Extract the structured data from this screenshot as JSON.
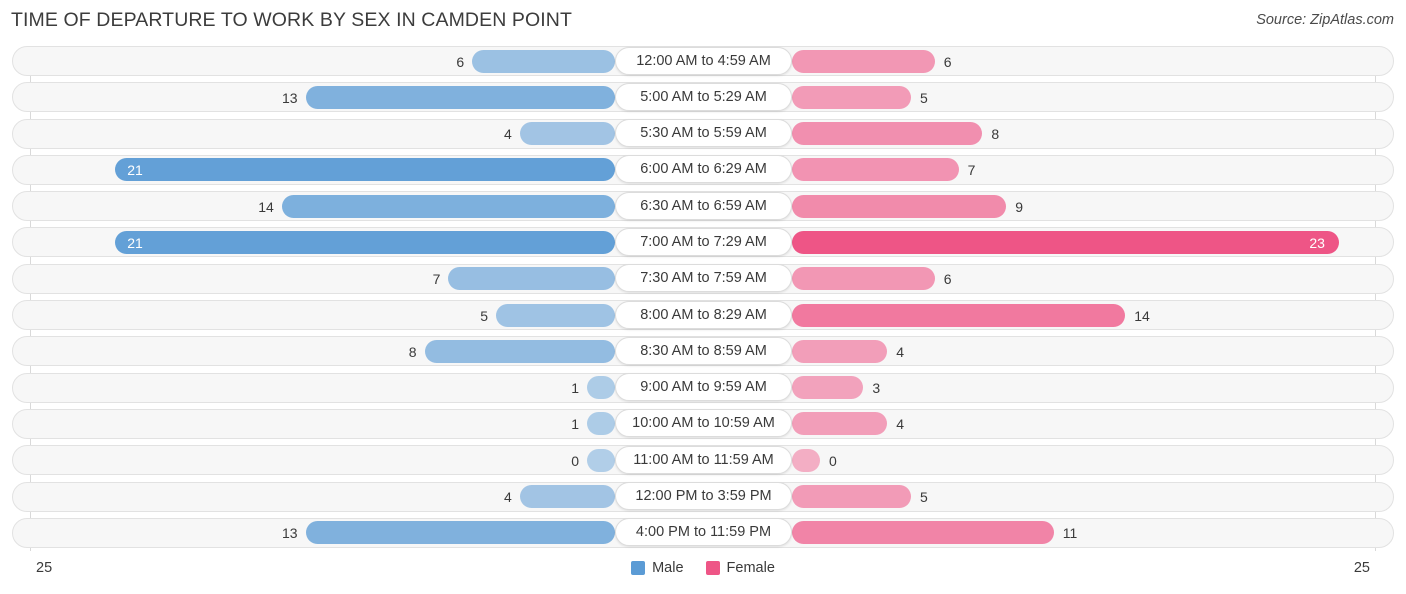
{
  "header": {
    "title": "TIME OF DEPARTURE TO WORK BY SEX IN CAMDEN POINT",
    "source": "Source: ZipAtlas.com"
  },
  "legend": {
    "male_label": "Male",
    "female_label": "Female",
    "male_color": "#5b9bd5",
    "female_color": "#ee5586"
  },
  "axis": {
    "left_max": "25",
    "right_max": "25"
  },
  "chart_data": {
    "type": "bar",
    "subtype": "diverging-bidirectional-bar",
    "title": "TIME OF DEPARTURE TO WORK BY SEX IN CAMDEN POINT",
    "xlabel": "",
    "ylabel": "",
    "xlim": [
      25,
      25
    ],
    "grid": true,
    "legend_position": "bottom-center",
    "categories": [
      "12:00 AM to 4:59 AM",
      "5:00 AM to 5:29 AM",
      "5:30 AM to 5:59 AM",
      "6:00 AM to 6:29 AM",
      "6:30 AM to 6:59 AM",
      "7:00 AM to 7:29 AM",
      "7:30 AM to 7:59 AM",
      "8:00 AM to 8:29 AM",
      "8:30 AM to 8:59 AM",
      "9:00 AM to 9:59 AM",
      "10:00 AM to 10:59 AM",
      "11:00 AM to 11:59 AM",
      "12:00 PM to 3:59 PM",
      "4:00 PM to 11:59 PM"
    ],
    "series": [
      {
        "name": "Male",
        "direction": "left",
        "color": "#5b9bd5",
        "values": [
          6,
          13,
          4,
          21,
          14,
          21,
          7,
          5,
          8,
          1,
          1,
          0,
          4,
          13
        ]
      },
      {
        "name": "Female",
        "direction": "right",
        "color": "#ee5586",
        "values": [
          6,
          5,
          8,
          7,
          9,
          23,
          6,
          14,
          4,
          3,
          4,
          0,
          5,
          11
        ]
      }
    ]
  }
}
